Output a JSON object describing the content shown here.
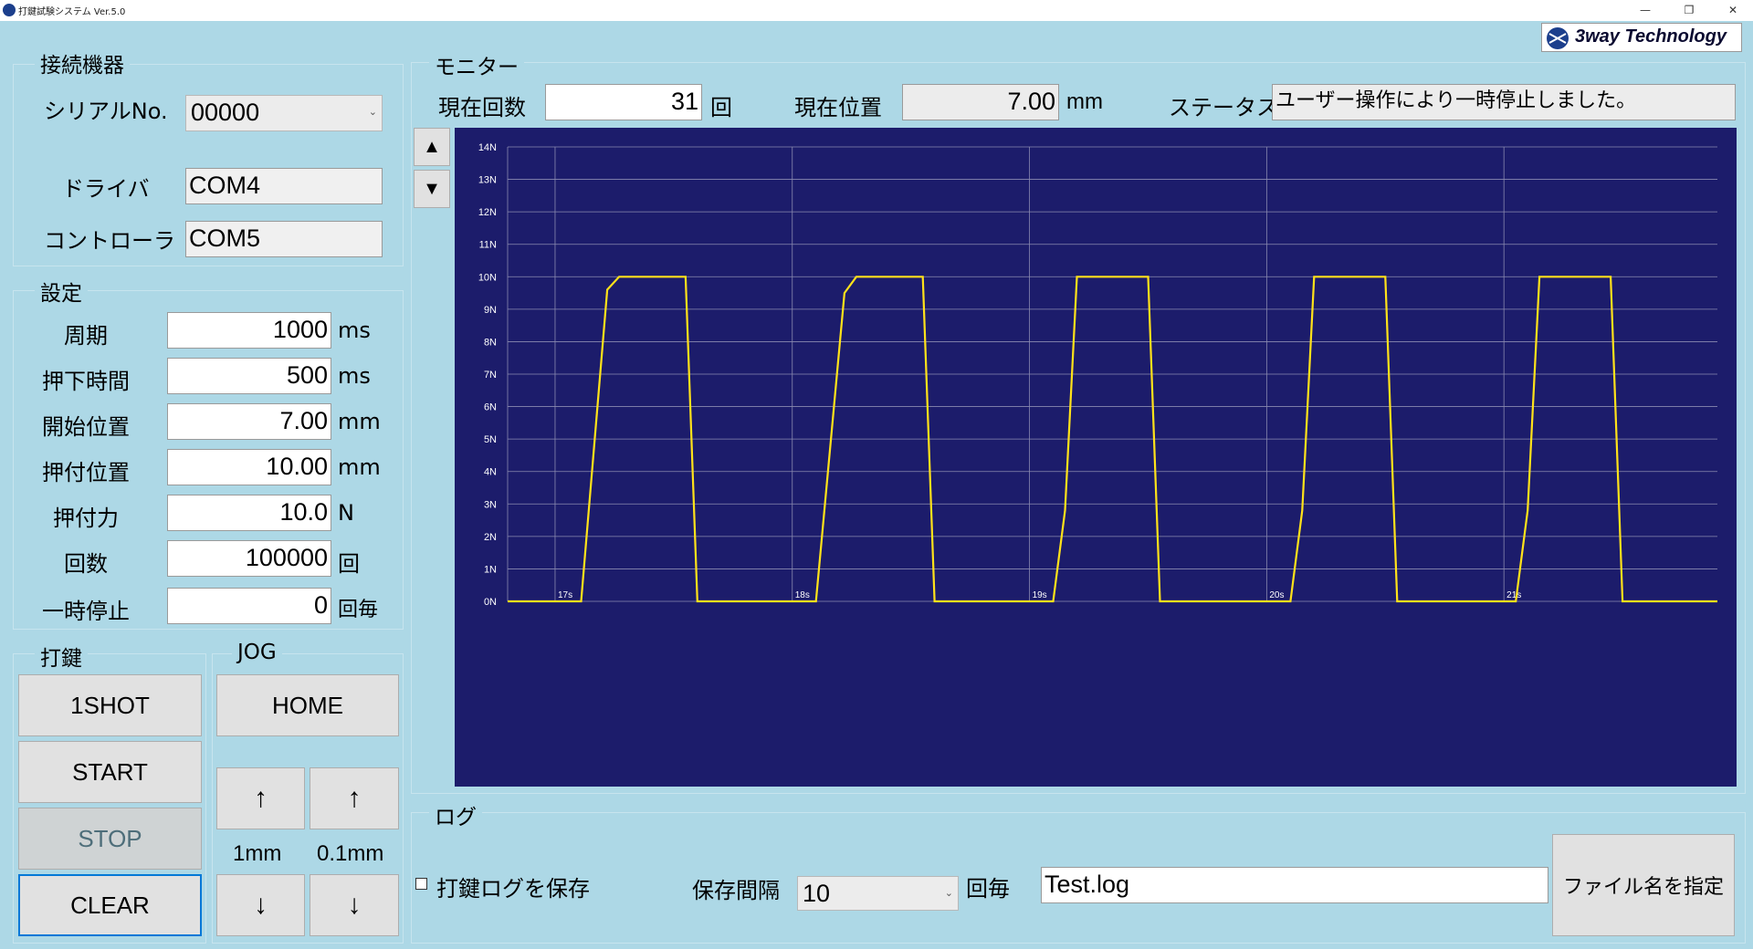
{
  "window": {
    "title": "打鍵試験システム Ver.5.0",
    "controls": [
      "—",
      "❐",
      "✕"
    ]
  },
  "logo": {
    "text": "3way Technology"
  },
  "device": {
    "title": "接続機器",
    "serial_label": "シリアルNo.",
    "serial_value": "00000",
    "driver_label": "ドライバ",
    "driver_value": "COM4",
    "controller_label": "コントローラ",
    "controller_value": "COM5"
  },
  "settings": {
    "title": "設定",
    "rows": [
      {
        "label": "周期",
        "value": "1000",
        "unit": "ms"
      },
      {
        "label": "押下時間",
        "value": "500",
        "unit": "ms"
      },
      {
        "label": "開始位置",
        "value": "7.00",
        "unit": "mm"
      },
      {
        "label": "押付位置",
        "value": "10.00",
        "unit": "mm"
      },
      {
        "label": "押付力",
        "value": "10.0",
        "unit": "N"
      },
      {
        "label": "回数",
        "value": "100000",
        "unit": "回"
      },
      {
        "label": "一時停止",
        "value": "0",
        "unit": "回毎"
      }
    ]
  },
  "keystroke": {
    "title": "打鍵",
    "buttons": [
      "1SHOT",
      "START",
      "STOP",
      "CLEAR"
    ]
  },
  "jog": {
    "title": "JOG",
    "home": "HOME",
    "up": "↑",
    "down": "↓",
    "step1": "1mm",
    "step2": "0.1mm"
  },
  "monitor": {
    "title": "モニター",
    "count_label": "現在回数",
    "count_value": "31",
    "count_unit": "回",
    "pos_label": "現在位置",
    "pos_value": "7.00",
    "pos_unit": "mm",
    "status_label": "ステータス",
    "status_value": "ユーザー操作により一時停止しました。",
    "scroll_up": "▲",
    "scroll_down": "▼"
  },
  "colors": {
    "background": "#add8e6",
    "plot_bg": "#1c1c6b",
    "trace": "#ffe21a",
    "grid": "#8a8ab0"
  },
  "chart_data": {
    "type": "line",
    "ylim": [
      0,
      14
    ],
    "xlim": [
      16.8,
      21.9
    ],
    "y_ticks": [
      "0N",
      "1N",
      "2N",
      "3N",
      "4N",
      "5N",
      "6N",
      "7N",
      "8N",
      "9N",
      "10N",
      "11N",
      "12N",
      "13N",
      "14N"
    ],
    "x_ticks": [
      {
        "value": 17,
        "label": "17s"
      },
      {
        "value": 18,
        "label": "18s"
      },
      {
        "value": 19,
        "label": "19s"
      },
      {
        "value": 20,
        "label": "20s"
      },
      {
        "value": 21,
        "label": "21s"
      }
    ],
    "series": [
      {
        "values": [
          [
            16.8,
            0
          ],
          [
            17.11,
            0
          ],
          [
            17.22,
            9.6
          ],
          [
            17.27,
            10
          ],
          [
            17.55,
            10
          ],
          [
            17.6,
            0
          ],
          [
            18.1,
            0
          ],
          [
            18.22,
            9.5
          ],
          [
            18.27,
            10
          ],
          [
            18.55,
            10
          ],
          [
            18.6,
            0
          ],
          [
            19.1,
            0
          ],
          [
            19.15,
            2.8
          ],
          [
            19.2,
            10
          ],
          [
            19.5,
            10
          ],
          [
            19.55,
            0
          ],
          [
            20.1,
            0
          ],
          [
            20.15,
            2.8
          ],
          [
            20.2,
            10
          ],
          [
            20.5,
            10
          ],
          [
            20.55,
            0
          ],
          [
            21.05,
            0
          ],
          [
            21.1,
            2.8
          ],
          [
            21.15,
            10
          ],
          [
            21.45,
            10
          ],
          [
            21.5,
            0
          ],
          [
            21.9,
            0
          ]
        ]
      }
    ]
  },
  "log": {
    "title": "ログ",
    "save_label": "打鍵ログを保存",
    "save_checked": false,
    "interval_label": "保存間隔",
    "interval_value": "10",
    "interval_unit": "回毎",
    "filename_value": "Test.log",
    "filename_button": "ファイル名を指定"
  }
}
